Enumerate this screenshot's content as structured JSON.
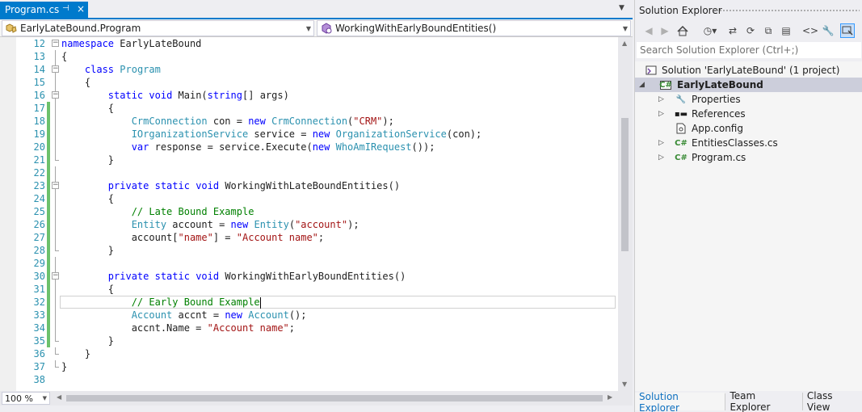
{
  "editor": {
    "tab": {
      "title": "Program.cs",
      "pin": "⊣",
      "close": "×"
    },
    "nav": {
      "class_combo": "EarlyLateBound.Program",
      "member_combo": "WorkingWithEarlyBoundEntities()"
    },
    "zoom": "100 %",
    "lines": [
      {
        "num": "12",
        "code": "namespace EarlyLateBound"
      },
      {
        "num": "13",
        "code": "{"
      },
      {
        "num": "14",
        "code": "    class Program"
      },
      {
        "num": "15",
        "code": "    {"
      },
      {
        "num": "16",
        "code": "        static void Main(string[] args)"
      },
      {
        "num": "17",
        "code": "        {"
      },
      {
        "num": "18",
        "code": "            CrmConnection con = new CrmConnection(\"CRM\");"
      },
      {
        "num": "19",
        "code": "            IOrganizationService service = new OrganizationService(con);"
      },
      {
        "num": "20",
        "code": "            var response = service.Execute(new WhoAmIRequest());"
      },
      {
        "num": "21",
        "code": "        }"
      },
      {
        "num": "22",
        "code": ""
      },
      {
        "num": "23",
        "code": "        private static void WorkingWithLateBoundEntities()"
      },
      {
        "num": "24",
        "code": "        {"
      },
      {
        "num": "25",
        "code": "            // Late Bound Example"
      },
      {
        "num": "26",
        "code": "            Entity account = new Entity(\"account\");"
      },
      {
        "num": "27",
        "code": "            account[\"name\"] = \"Account name\";"
      },
      {
        "num": "28",
        "code": "        }"
      },
      {
        "num": "29",
        "code": ""
      },
      {
        "num": "30",
        "code": "        private static void WorkingWithEarlyBoundEntities()"
      },
      {
        "num": "31",
        "code": "        {"
      },
      {
        "num": "32",
        "code": "            // Early Bound Example"
      },
      {
        "num": "33",
        "code": "            Account accnt = new Account();"
      },
      {
        "num": "34",
        "code": "            accnt.Name = \"Account name\";"
      },
      {
        "num": "35",
        "code": "        }"
      },
      {
        "num": "36",
        "code": "    }"
      },
      {
        "num": "37",
        "code": "}"
      },
      {
        "num": "38",
        "code": ""
      }
    ]
  },
  "solution_explorer": {
    "title": "Solution Explorer",
    "search_placeholder": "Search Solution Explorer (Ctrl+;)",
    "tree": {
      "solution": "Solution 'EarlyLateBound' (1 project)",
      "project": "EarlyLateBound",
      "items": [
        "Properties",
        "References",
        "App.config",
        "EntitiesClasses.cs",
        "Program.cs"
      ]
    },
    "bottom_tabs": [
      "Solution Explorer",
      "Team Explorer",
      "Class View"
    ]
  },
  "colors": {
    "accent": "#007acc",
    "keyword": "#0000ff",
    "type": "#2b91af",
    "string": "#a31515",
    "comment": "#008000",
    "change_saved": "#6cc16c"
  }
}
